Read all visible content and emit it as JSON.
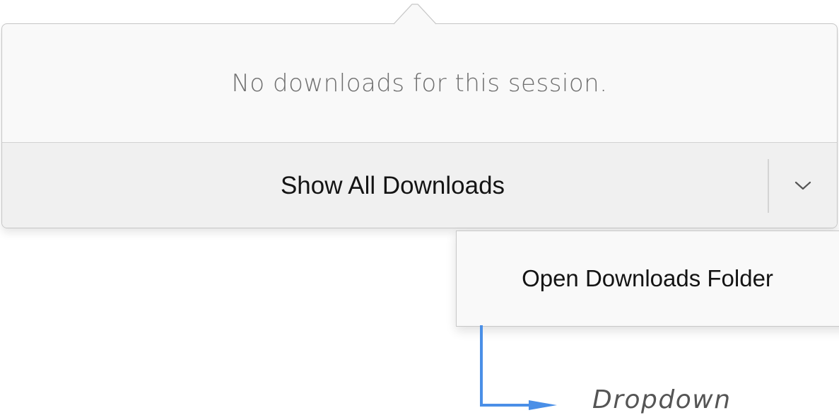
{
  "panel": {
    "empty_message": "No downloads for this session.",
    "show_all_label": "Show All Downloads",
    "dropdown_icon": "chevron-down-icon"
  },
  "dropdown_menu": {
    "items": [
      {
        "label": "Open Downloads Folder"
      }
    ]
  },
  "annotation": {
    "label": "Dropdown",
    "color": "#4a8fe7"
  }
}
